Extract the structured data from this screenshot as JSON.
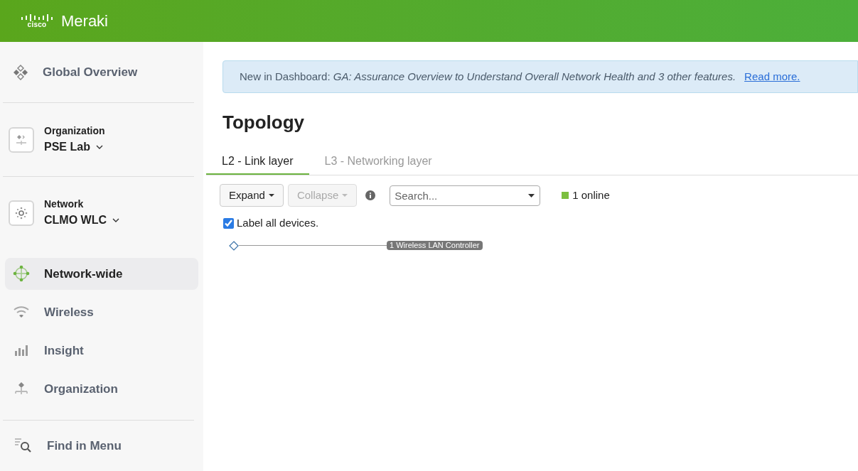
{
  "header": {
    "logo_word": "cisco",
    "product": "Meraki"
  },
  "sidebar": {
    "overview": "Global Overview",
    "organization": {
      "caption": "Organization",
      "name": "PSE Lab"
    },
    "network": {
      "caption": "Network",
      "name": "CLMO WLC"
    },
    "items": [
      {
        "label": "Network-wide",
        "selected": true
      },
      {
        "label": "Wireless",
        "selected": false
      },
      {
        "label": "Insight",
        "selected": false
      },
      {
        "label": "Organization",
        "selected": false
      }
    ],
    "find": "Find in Menu"
  },
  "banner": {
    "text": "New in Dashboard: *GA: Assurance Overview to Understand Overall Network Health and 3 other features.*",
    "link": "Read more."
  },
  "title": "Topology",
  "tabs": [
    {
      "label": "L2 - Link layer",
      "selected": true
    },
    {
      "label": "L3 - Networking layer",
      "selected": false
    }
  ],
  "toolbar": {
    "buttons": [
      {
        "label": "Expand",
        "disabled": false
      },
      {
        "label": "Collapse",
        "disabled": true
      }
    ],
    "search": {
      "placeholder": "Search..."
    },
    "legend": {
      "label": "1 online",
      "color": "#7cbf3f"
    }
  },
  "label_all": {
    "label": "Label all devices.",
    "checked": true
  },
  "node": {
    "label": "1 Wireless LAN Controller"
  }
}
